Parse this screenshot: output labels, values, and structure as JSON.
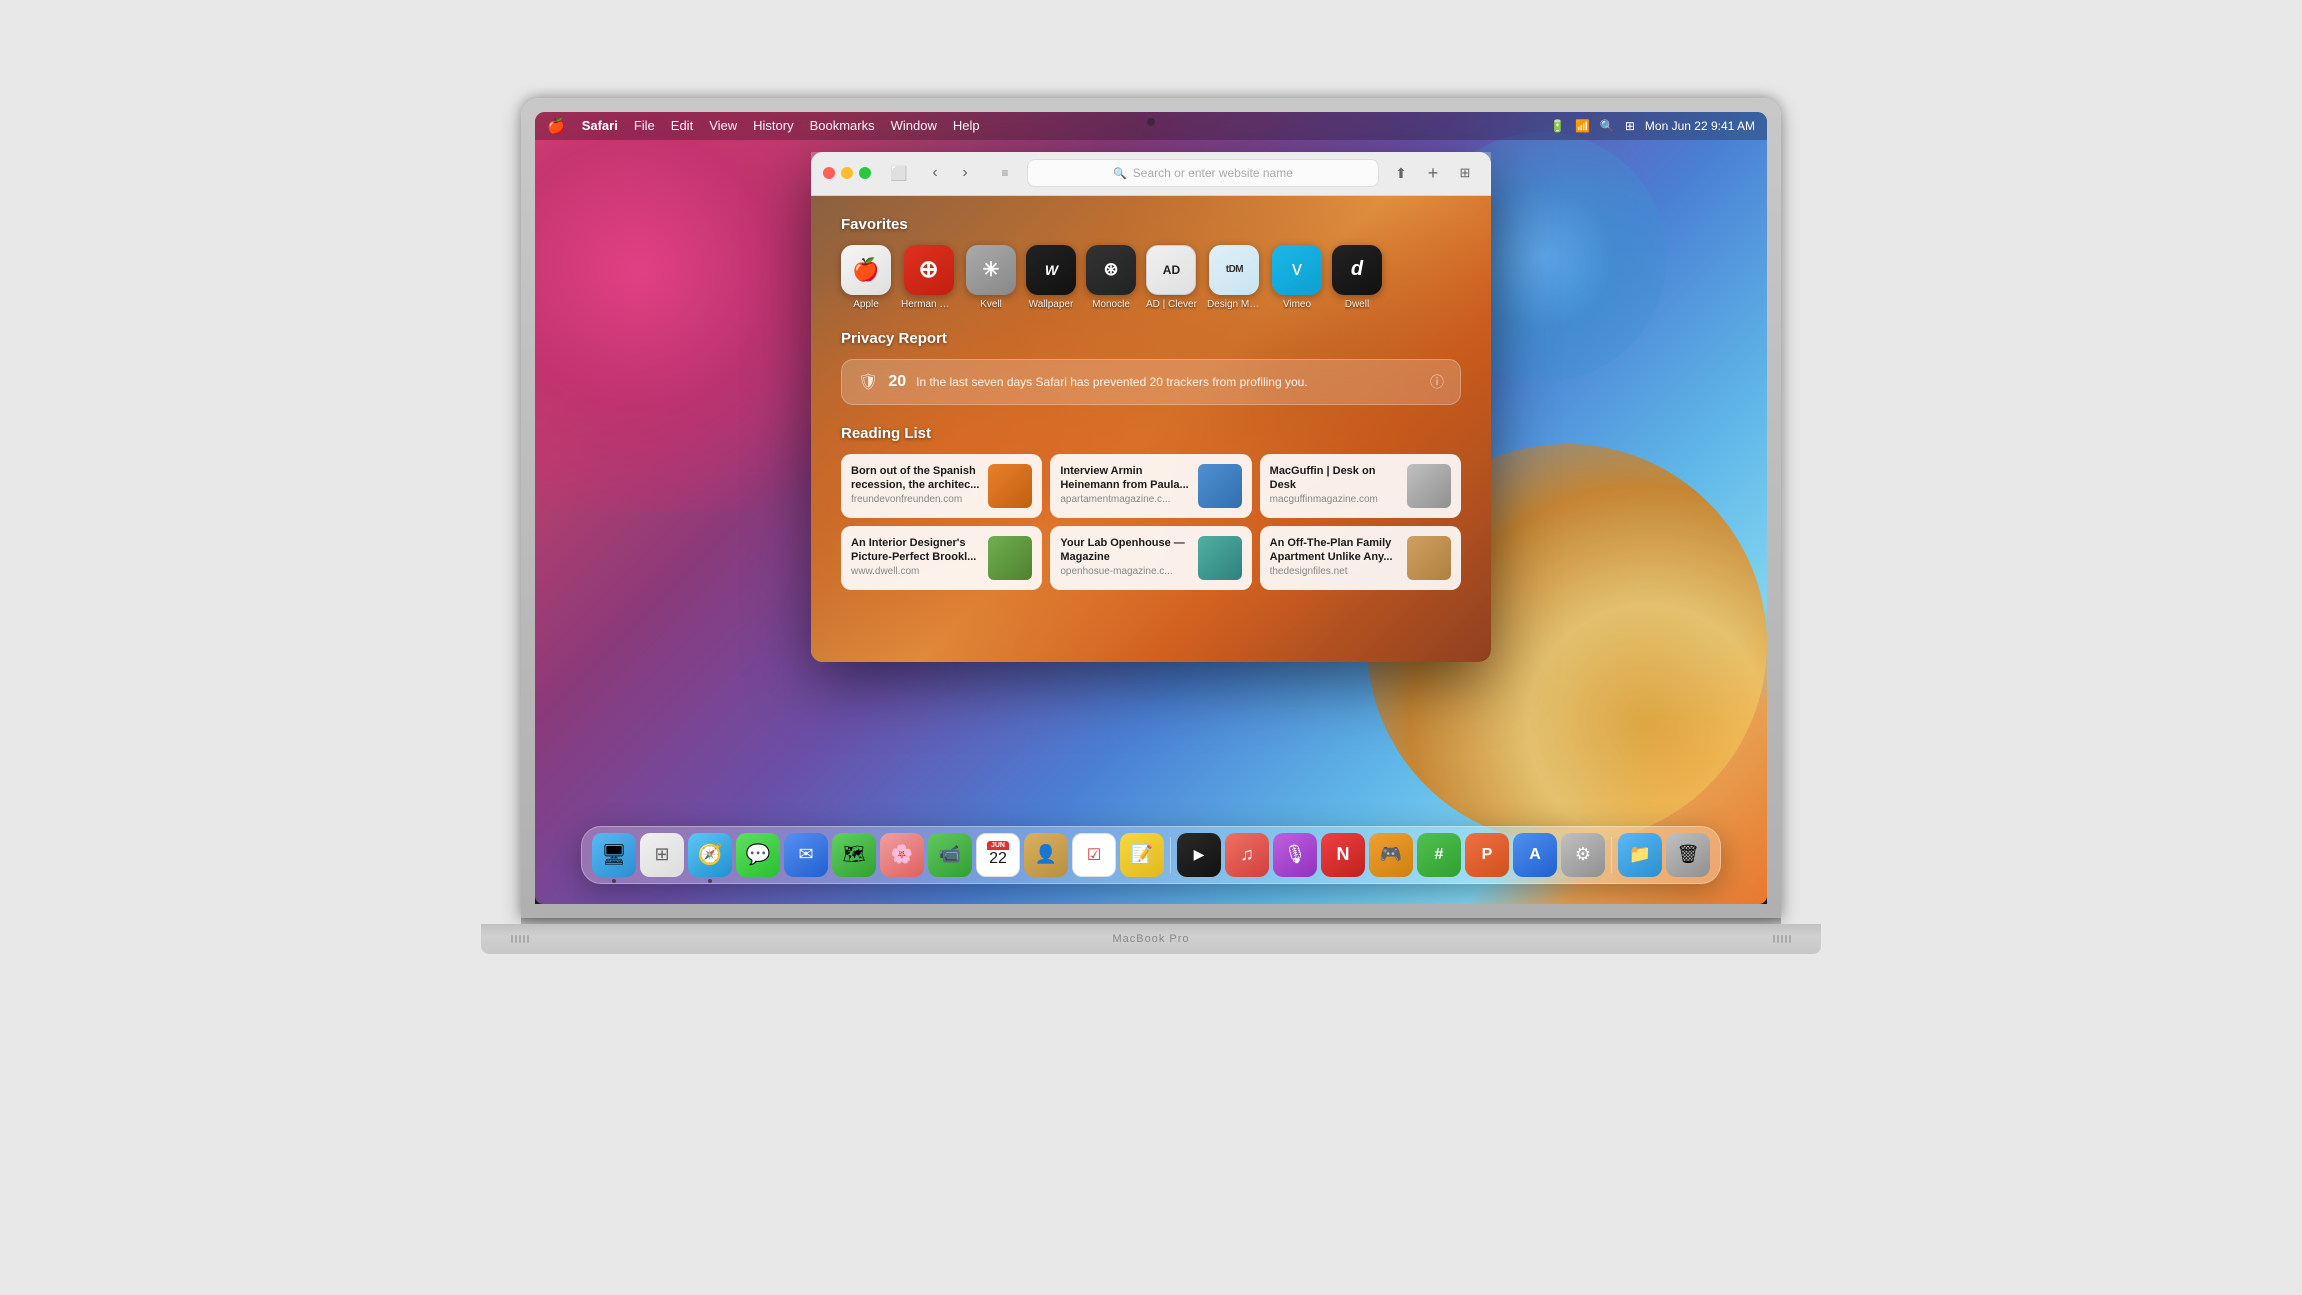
{
  "menubar": {
    "apple_logo": "🍎",
    "app_name": "Safari",
    "menus": [
      "File",
      "Edit",
      "View",
      "History",
      "Bookmarks",
      "Window",
      "Help"
    ],
    "right": {
      "battery": "🔋",
      "wifi": "WiFi",
      "time": "Mon Jun 22  9:41 AM"
    }
  },
  "safari": {
    "address_bar": {
      "placeholder": "Search or enter website name"
    },
    "favorites": {
      "title": "Favorites",
      "items": [
        {
          "label": "Apple",
          "icon": "🍎",
          "class": "fav-apple"
        },
        {
          "label": "Herman Miller",
          "icon": "◉",
          "class": "fav-herman"
        },
        {
          "label": "Kvell",
          "icon": "✳",
          "class": "fav-kvell"
        },
        {
          "label": "Wallpaper",
          "icon": "⊛",
          "class": "fav-wallpaper"
        },
        {
          "label": "Monocle",
          "icon": "⊚",
          "class": "fav-monocle"
        },
        {
          "label": "AD | Clever",
          "icon": "AD",
          "class": "fav-ad"
        },
        {
          "label": "Design Museum",
          "icon": "tDM",
          "class": "fav-design"
        },
        {
          "label": "Vimeo",
          "icon": "▷",
          "class": "fav-vimeo"
        },
        {
          "label": "Dwell",
          "icon": "d",
          "class": "fav-dwell"
        }
      ]
    },
    "privacy": {
      "title": "Privacy Report",
      "count": "20",
      "message": "In the last seven days Safari has prevented 20 trackers from profiling you."
    },
    "reading_list": {
      "title": "Reading List",
      "items": [
        {
          "title": "Born out of the Spanish recession, the architec...",
          "url": "freundevonfreunden.com",
          "thumb_class": "thumb-orange"
        },
        {
          "title": "Interview Armin Heinemann from Paula...",
          "url": "apartamentmagazine.c...",
          "thumb_class": "thumb-blue"
        },
        {
          "title": "MacGuffin | Desk on Desk",
          "url": "macguffinmagazine.com",
          "thumb_class": "thumb-gray"
        },
        {
          "title": "An Interior Designer's Picture-Perfect Brookl...",
          "url": "www.dwell.com",
          "thumb_class": "thumb-green"
        },
        {
          "title": "Your Lab Openhouse — Magazine",
          "url": "openhosue-magazine.c...",
          "thumb_class": "thumb-teal"
        },
        {
          "title": "An Off-The-Plan Family Apartment Unlike Any...",
          "url": "thedesignfiles.net",
          "thumb_class": "thumb-warm"
        }
      ]
    }
  },
  "dock": {
    "apps": [
      {
        "name": "Finder",
        "class": "d-finder",
        "icon": "🖥",
        "running": true
      },
      {
        "name": "Launchpad",
        "class": "d-launchpad",
        "icon": "⊞",
        "running": false
      },
      {
        "name": "Safari",
        "class": "d-safari",
        "icon": "🧭",
        "running": true
      },
      {
        "name": "Messages",
        "class": "d-messages",
        "icon": "💬",
        "running": false
      },
      {
        "name": "Mail",
        "class": "d-mail",
        "icon": "✉",
        "running": false
      },
      {
        "name": "Maps",
        "class": "d-maps",
        "icon": "🗺",
        "running": false
      },
      {
        "name": "Photos",
        "class": "d-photos",
        "icon": "⚘",
        "running": false
      },
      {
        "name": "FaceTime",
        "class": "d-facetime",
        "icon": "📹",
        "running": false
      },
      {
        "name": "Calendar",
        "class": "d-calendar",
        "icon": "📅",
        "running": false
      },
      {
        "name": "Contacts",
        "class": "d-contacts",
        "icon": "👤",
        "running": false
      },
      {
        "name": "Reminders",
        "class": "d-reminders",
        "icon": "☑",
        "running": false
      },
      {
        "name": "Notes",
        "class": "d-notes",
        "icon": "📝",
        "running": false
      },
      {
        "name": "Apple TV",
        "class": "d-appletv",
        "icon": "▶",
        "running": false
      },
      {
        "name": "Music",
        "class": "d-music",
        "icon": "♫",
        "running": false
      },
      {
        "name": "Podcasts",
        "class": "d-podcasts",
        "icon": "🎙",
        "running": false
      },
      {
        "name": "News",
        "class": "d-news",
        "icon": "N",
        "running": false
      },
      {
        "name": "Arcade",
        "class": "d-arcade",
        "icon": "🎮",
        "running": false
      },
      {
        "name": "Numbers",
        "class": "d-numbers",
        "icon": "#",
        "running": false
      },
      {
        "name": "Pages",
        "class": "d-pages",
        "icon": "P",
        "running": false
      },
      {
        "name": "App Store",
        "class": "d-appstore",
        "icon": "A",
        "running": false
      },
      {
        "name": "System Preferences",
        "class": "d-prefs",
        "icon": "⚙",
        "running": false
      },
      {
        "name": "Files",
        "class": "d-files",
        "icon": "📁",
        "running": false
      },
      {
        "name": "Trash",
        "class": "d-trash",
        "icon": "🗑",
        "running": false
      }
    ]
  },
  "macbook": {
    "model_name": "MacBook Pro"
  }
}
